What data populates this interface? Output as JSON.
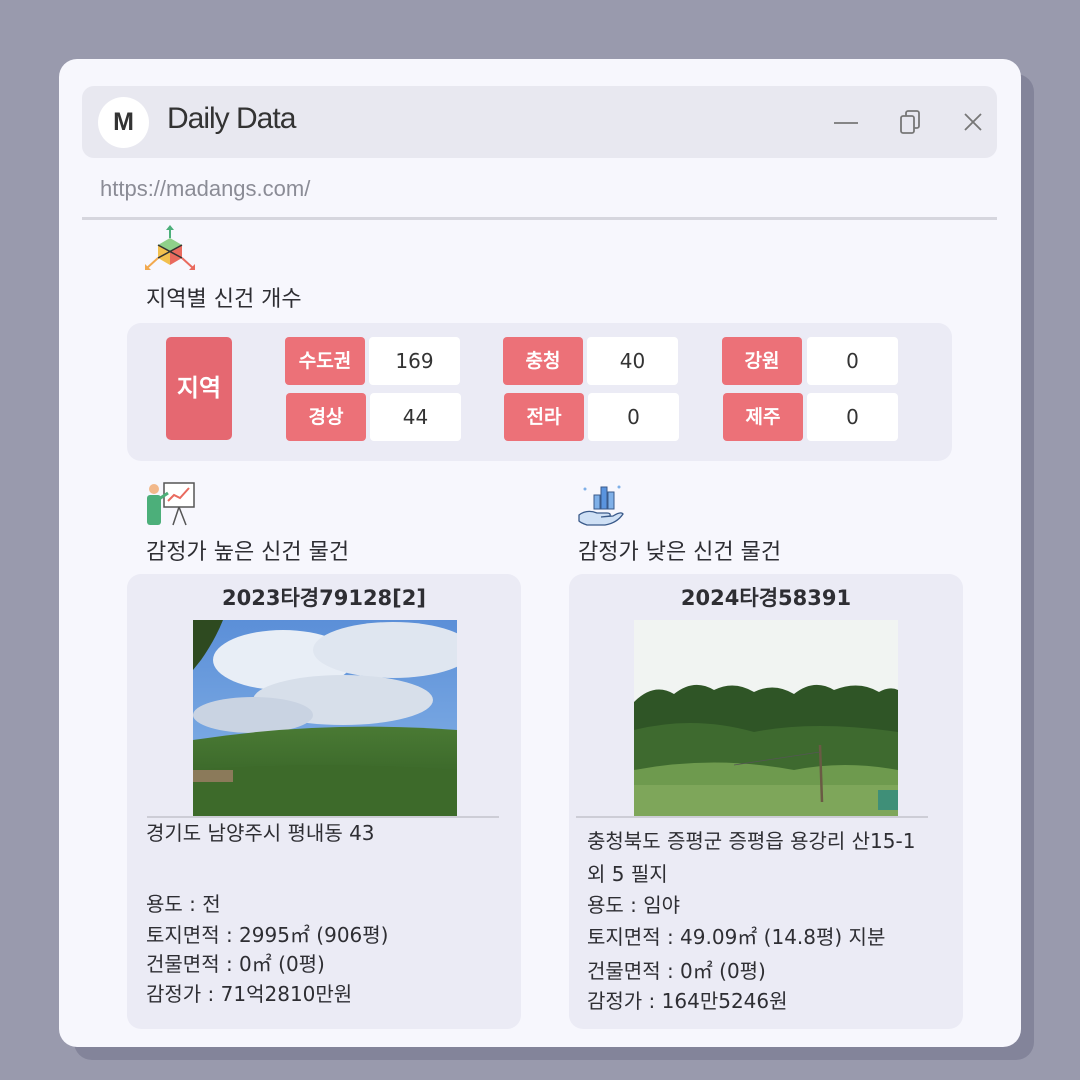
{
  "window": {
    "logo_letter": "M",
    "title": "Daily Data",
    "url": "https://madangs.com/"
  },
  "regions_section": {
    "title": "지역별 신건 개수",
    "header_label": "지역",
    "items": [
      {
        "label": "수도권",
        "value": "169"
      },
      {
        "label": "충청",
        "value": "40"
      },
      {
        "label": "강원",
        "value": "0"
      },
      {
        "label": "경상",
        "value": "44"
      },
      {
        "label": "전라",
        "value": "0"
      },
      {
        "label": "제주",
        "value": "0"
      }
    ]
  },
  "high_section": {
    "title": "감정가 높은 신건 물건",
    "case_no": "2023타경79128[2]",
    "address": "경기도 남양주시 평내동 43",
    "usage": "용도 : 전",
    "land_area": "토지면적 : 2995㎡ (906평)",
    "building_area": "건물면적 : 0㎡ (0평)",
    "appraisal": "감정가 : 71억2810만원"
  },
  "low_section": {
    "title": "감정가 낮은 신건 물건",
    "case_no": "2024타경58391",
    "address_line1": "충청북도 증평군 증평읍 용강리 산15-1",
    "address_line2": "외 5 필지",
    "usage": "용도 : 임야",
    "land_area": "토지면적 : 49.09㎡ (14.8평) 지분",
    "building_area": "건물면적 : 0㎡ (0평)",
    "appraisal": "감정가 : 164만5246원"
  },
  "colors": {
    "accent_red": "#ec7178",
    "window_bg": "#f7f7fd",
    "panel_bg": "#ebebf5"
  },
  "icons": [
    "cube-axes-icon",
    "presentation-chart-icon",
    "hand-bar-chart-icon",
    "minimize-icon",
    "restore-icon",
    "close-icon"
  ]
}
